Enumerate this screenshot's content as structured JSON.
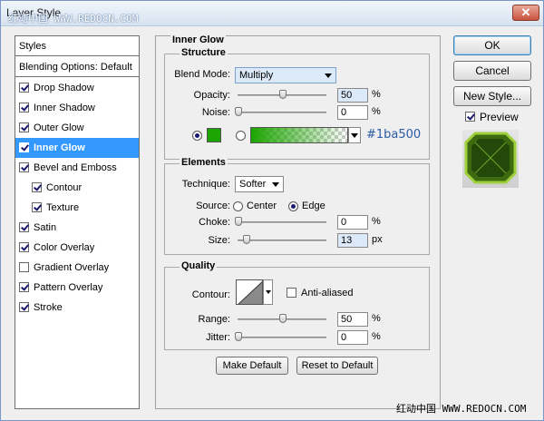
{
  "window": {
    "title": "Layer Style",
    "watermark": "红动中国 WWW.REDOCN.COM",
    "close_label": "✕"
  },
  "styles_list": {
    "header": "Styles",
    "blending": "Blending Options: Default",
    "items": [
      {
        "label": "Drop Shadow",
        "checked": true,
        "indent": false,
        "selected": false
      },
      {
        "label": "Inner Shadow",
        "checked": true,
        "indent": false,
        "selected": false
      },
      {
        "label": "Outer Glow",
        "checked": true,
        "indent": false,
        "selected": false
      },
      {
        "label": "Inner Glow",
        "checked": true,
        "indent": false,
        "selected": true
      },
      {
        "label": "Bevel and Emboss",
        "checked": true,
        "indent": false,
        "selected": false
      },
      {
        "label": "Contour",
        "checked": true,
        "indent": true,
        "selected": false
      },
      {
        "label": "Texture",
        "checked": true,
        "indent": true,
        "selected": false
      },
      {
        "label": "Satin",
        "checked": true,
        "indent": false,
        "selected": false
      },
      {
        "label": "Color Overlay",
        "checked": true,
        "indent": false,
        "selected": false
      },
      {
        "label": "Gradient Overlay",
        "checked": false,
        "indent": false,
        "selected": false
      },
      {
        "label": "Pattern Overlay",
        "checked": true,
        "indent": false,
        "selected": false
      },
      {
        "label": "Stroke",
        "checked": true,
        "indent": false,
        "selected": false
      }
    ]
  },
  "inner_glow": {
    "title": "Inner Glow",
    "structure": {
      "title": "Structure",
      "blend_mode_label": "Blend Mode:",
      "blend_mode_value": "Multiply",
      "opacity_label": "Opacity:",
      "opacity_value": "50",
      "opacity_unit": "%",
      "noise_label": "Noise:",
      "noise_value": "0",
      "noise_unit": "%",
      "color_hex": "#1ba500",
      "color_label": "#1ba500"
    },
    "elements": {
      "title": "Elements",
      "technique_label": "Technique:",
      "technique_value": "Softer",
      "source_label": "Source:",
      "source_center": "Center",
      "source_edge": "Edge",
      "choke_label": "Choke:",
      "choke_value": "0",
      "choke_unit": "%",
      "size_label": "Size:",
      "size_value": "13",
      "size_unit": "px"
    },
    "quality": {
      "title": "Quality",
      "contour_label": "Contour:",
      "anti_aliased_label": "Anti-aliased",
      "range_label": "Range:",
      "range_value": "50",
      "range_unit": "%",
      "jitter_label": "Jitter:",
      "jitter_value": "0",
      "jitter_unit": "%"
    },
    "make_default": "Make Default",
    "reset_default": "Reset to Default"
  },
  "side_buttons": {
    "ok": "OK",
    "cancel": "Cancel",
    "new_style": "New Style...",
    "preview_label": "Preview"
  },
  "footer_watermark": "红动中国 WWW.REDOCN.COM"
}
